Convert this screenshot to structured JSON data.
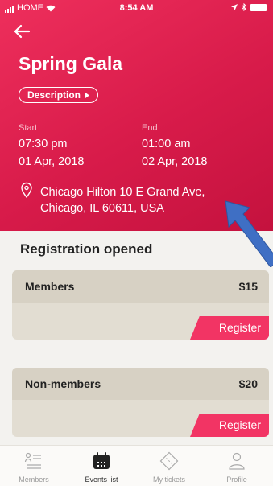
{
  "status_bar": {
    "carrier": "HOME",
    "time": "8:54 AM"
  },
  "event": {
    "title": "Spring Gala",
    "description_label": "Description",
    "start_label": "Start",
    "start_time": "07:30 pm",
    "start_date": "01 Apr, 2018",
    "end_label": "End",
    "end_time": "01:00 am",
    "end_date": "02 Apr, 2018",
    "venue_line1": "Chicago Hilton 10 E Grand Ave,",
    "venue_line2": "Chicago, IL 60611, USA"
  },
  "registration": {
    "heading": "Registration opened",
    "tickets": [
      {
        "name": "Members",
        "price": "$15",
        "button": "Register"
      },
      {
        "name": "Non-members",
        "price": "$20",
        "button": "Register"
      }
    ]
  },
  "tabbar": {
    "items": [
      {
        "label": "Members",
        "icon": "members-list-icon"
      },
      {
        "label": "Events list",
        "icon": "calendar-icon",
        "active": true
      },
      {
        "label": "My tickets",
        "icon": "ticket-icon"
      },
      {
        "label": "Profile",
        "icon": "profile-icon"
      }
    ]
  },
  "colors": {
    "accent": "#e8244f",
    "register": "#f23464",
    "card": "#e2ddd2",
    "annotation_arrow": "#3f6fc4"
  }
}
